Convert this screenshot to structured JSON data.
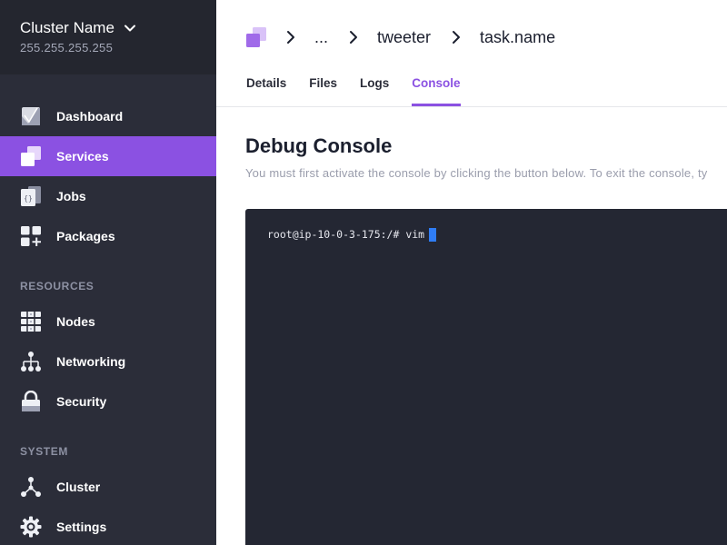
{
  "sidebar": {
    "cluster_name": "Cluster Name",
    "cluster_ip": "255.255.255.255",
    "items": [
      {
        "label": "Dashboard",
        "icon": "dashboard-icon",
        "active": false
      },
      {
        "label": "Services",
        "icon": "services-icon",
        "active": true
      },
      {
        "label": "Jobs",
        "icon": "jobs-icon",
        "active": false
      },
      {
        "label": "Packages",
        "icon": "packages-icon",
        "active": false
      }
    ],
    "resources_heading": "RESOURCES",
    "resources": [
      {
        "label": "Nodes",
        "icon": "nodes-icon"
      },
      {
        "label": "Networking",
        "icon": "networking-icon"
      },
      {
        "label": "Security",
        "icon": "lock-icon"
      }
    ],
    "system_heading": "SYSTEM",
    "system": [
      {
        "label": "Cluster",
        "icon": "cluster-icon"
      },
      {
        "label": "Settings",
        "icon": "gear-icon"
      }
    ]
  },
  "breadcrumb": {
    "items": [
      "...",
      "tweeter",
      "task.name"
    ]
  },
  "tabs": [
    "Details",
    "Files",
    "Logs",
    "Console"
  ],
  "active_tab": "Console",
  "page": {
    "title": "Debug Console",
    "description": "You must first activate the console by clicking the button below. To exit the console, ty"
  },
  "console": {
    "line": "root@ip-10-0-3-175:/# vim"
  },
  "colors": {
    "accent": "#8b51e2",
    "sidebar_bg": "#2b2d39",
    "console_bg": "#242733",
    "cursor": "#2f7df6"
  }
}
